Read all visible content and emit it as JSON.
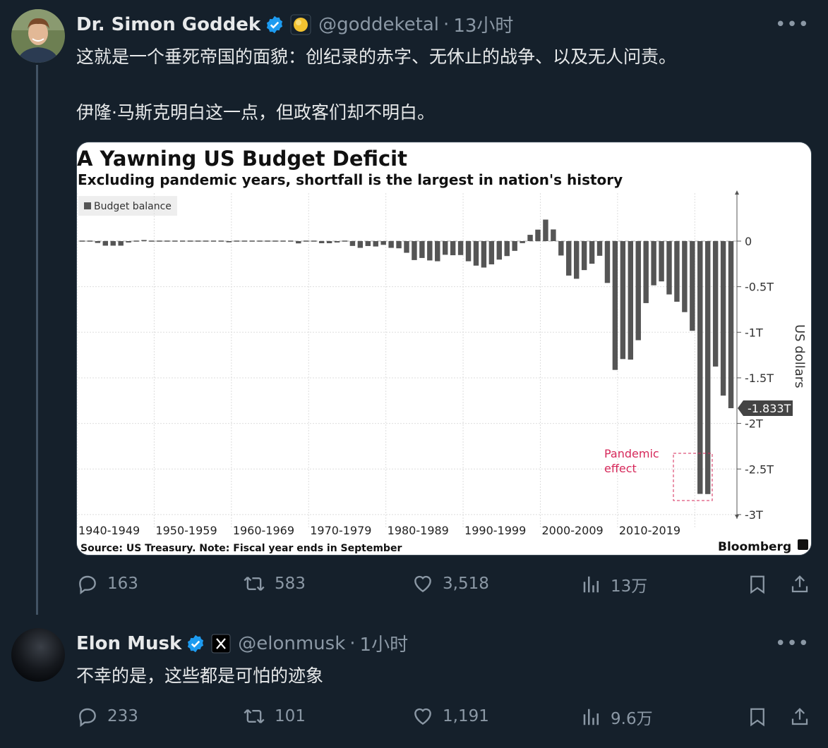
{
  "tweet1": {
    "author_name": "Dr. Simon Goddek",
    "handle": "@goddeketal",
    "time": "13小时",
    "text_line1": "这就是一个垂死帝国的面貌：创纪录的赤字、无休止的战争、以及无人问责。",
    "text_line2": "伊隆·马斯克明白这一点，但政客们却不明白。",
    "more": "•••",
    "stats": {
      "replies": "163",
      "retweets": "583",
      "likes": "3,518",
      "views": "13万"
    }
  },
  "tweet2": {
    "author_name": "Elon Musk",
    "handle": "@elonmusk",
    "time": "1小时",
    "text": "不幸的是，这些都是可怕的迹象",
    "more": "•••",
    "stats": {
      "replies": "233",
      "retweets": "101",
      "likes": "1,191",
      "views": "9.6万"
    }
  },
  "colors": {
    "background": "#15202b",
    "verified": "#1d9bf0",
    "bar": "#555555",
    "pandemic": "#d6285a"
  },
  "chart_data": {
    "type": "bar",
    "title": "A Yawning US Budget Deficit",
    "subtitle": "Excluding pandemic years, shortfall is the largest in nation's history",
    "legend": "Budget balance",
    "ylabel": "US dollars",
    "y_ticks": [
      "0",
      "-0.5T",
      "-1T",
      "-1.5T",
      "-2T",
      "-2.5T",
      "-3T"
    ],
    "ylim": [
      -3.0,
      0.5
    ],
    "x_ticks": [
      "1940-1949",
      "1950-1959",
      "1960-1969",
      "1970-1979",
      "1980-1989",
      "1990-1999",
      "2000-2009",
      "2010-2019"
    ],
    "last_value_label": "-1.833T",
    "annotation_line1": "Pandemic",
    "annotation_line2": "effect",
    "source": "Source: US Treasury. Note: Fiscal year ends in September",
    "brand": "Bloomberg",
    "x": [
      1940,
      1941,
      1942,
      1943,
      1944,
      1945,
      1946,
      1947,
      1948,
      1949,
      1950,
      1951,
      1952,
      1953,
      1954,
      1955,
      1956,
      1957,
      1958,
      1959,
      1960,
      1961,
      1962,
      1963,
      1964,
      1965,
      1966,
      1967,
      1968,
      1969,
      1970,
      1971,
      1972,
      1973,
      1974,
      1975,
      1976,
      1977,
      1978,
      1979,
      1980,
      1981,
      1982,
      1983,
      1984,
      1985,
      1986,
      1987,
      1988,
      1989,
      1990,
      1991,
      1992,
      1993,
      1994,
      1995,
      1996,
      1997,
      1998,
      1999,
      2000,
      2001,
      2002,
      2003,
      2004,
      2005,
      2006,
      2007,
      2008,
      2009,
      2010,
      2011,
      2012,
      2013,
      2014,
      2015,
      2016,
      2017,
      2018,
      2019,
      2020,
      2021,
      2022,
      2023,
      2024
    ],
    "values": [
      -0.003,
      -0.005,
      -0.02,
      -0.05,
      -0.05,
      -0.05,
      -0.015,
      0.004,
      0.012,
      0.001,
      -0.003,
      0.006,
      -0.002,
      -0.007,
      -0.001,
      -0.003,
      0.004,
      0.003,
      -0.003,
      -0.013,
      0.0003,
      -0.003,
      -0.007,
      -0.005,
      -0.006,
      -0.001,
      -0.004,
      -0.009,
      -0.025,
      0.003,
      -0.003,
      -0.023,
      -0.023,
      -0.015,
      -0.006,
      -0.053,
      -0.074,
      -0.054,
      -0.059,
      -0.041,
      -0.074,
      -0.079,
      -0.128,
      -0.208,
      -0.185,
      -0.212,
      -0.221,
      -0.15,
      -0.155,
      -0.153,
      -0.221,
      -0.269,
      -0.29,
      -0.255,
      -0.203,
      -0.164,
      -0.107,
      -0.022,
      0.069,
      0.126,
      0.236,
      0.128,
      -0.158,
      -0.378,
      -0.413,
      -0.318,
      -0.248,
      -0.161,
      -0.459,
      -1.413,
      -1.294,
      -1.3,
      -1.087,
      -0.68,
      -0.485,
      -0.442,
      -0.585,
      -0.665,
      -0.779,
      -0.984,
      -2.773,
      -2.775,
      -1.376,
      -1.695,
      -1.833
    ]
  }
}
